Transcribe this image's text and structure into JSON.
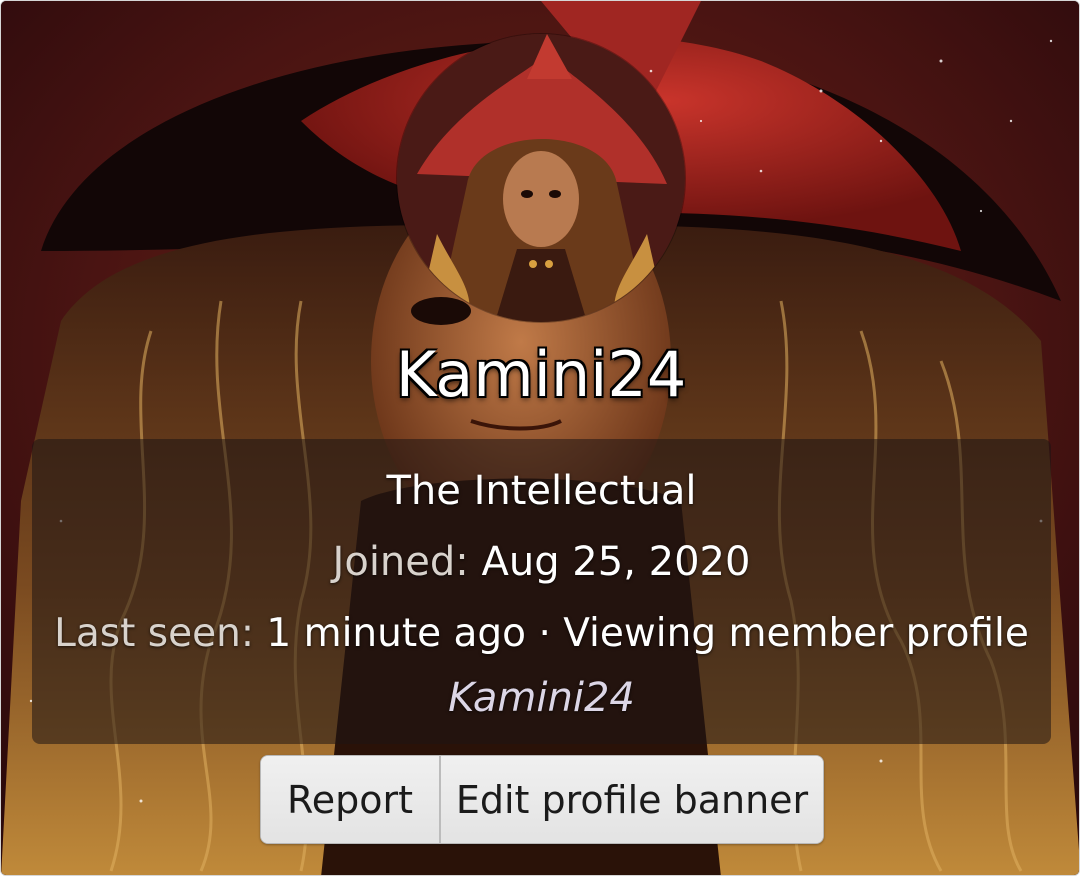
{
  "profile": {
    "username": "Kamini24",
    "user_title": "The Intellectual",
    "joined_label": "Joined:",
    "joined_value": "Aug 25, 2020",
    "last_seen_label": "Last seen:",
    "last_seen_value": "1 minute ago · Viewing member profile",
    "activity_target": "Kamini24"
  },
  "actions": {
    "report_label": "Report",
    "edit_banner_label": "Edit profile banner"
  },
  "colors": {
    "banner_red": "#8a1a18",
    "hat_red": "#c0302a",
    "hair_gold": "#c89040",
    "button_bg": "#e9e9e9"
  }
}
